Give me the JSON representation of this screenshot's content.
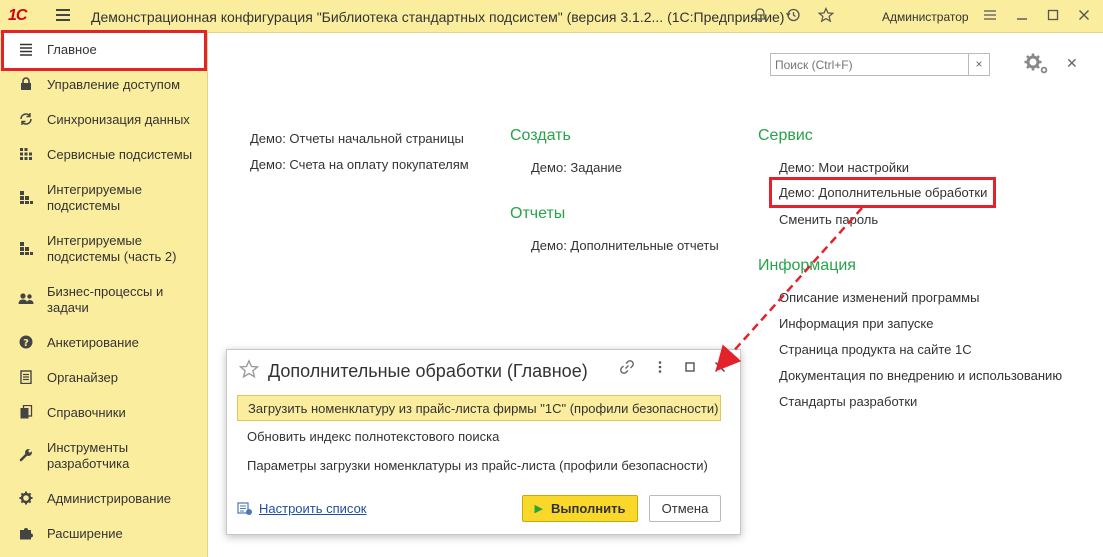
{
  "titlebar": {
    "logo": "1С",
    "title": "Демонстрационная конфигурация \"Библиотека стандартных подсистем\" (версия 3.1.2...   (1С:Предприятие)",
    "user": "Администратор"
  },
  "sidebar": {
    "items": [
      {
        "label": "Главное",
        "icon": "menu-icon"
      },
      {
        "label": "Управление доступом",
        "icon": "lock-icon"
      },
      {
        "label": "Синхронизация данных",
        "icon": "sync-icon"
      },
      {
        "label": "Сервисные подсистемы",
        "icon": "grid-icon"
      },
      {
        "label": "Интегрируемые подсистемы",
        "icon": "blocks-icon"
      },
      {
        "label": "Интегрируемые подсистемы (часть 2)",
        "icon": "blocks-icon"
      },
      {
        "label": "Бизнес-процессы и задачи",
        "icon": "users-icon"
      },
      {
        "label": "Анкетирование",
        "icon": "question-icon"
      },
      {
        "label": "Органайзер",
        "icon": "organizer-icon"
      },
      {
        "label": "Справочники",
        "icon": "books-icon"
      },
      {
        "label": "Инструменты разработчика",
        "icon": "wrench-icon"
      },
      {
        "label": "Администрирование",
        "icon": "gear-icon"
      },
      {
        "label": "Расширение",
        "icon": "puzzle-icon"
      }
    ]
  },
  "main": {
    "search_placeholder": "Поиск (Ctrl+F)",
    "col1": [
      "Демо: Отчеты начальной страницы",
      "Демо: Счета на оплату покупателям"
    ],
    "create_title": "Создать",
    "create_items": [
      "Демо: Задание"
    ],
    "reports_title": "Отчеты",
    "reports_items": [
      "Демо: Дополнительные отчеты"
    ],
    "service_title": "Сервис",
    "service_items": [
      "Демо: Мои настройки",
      "Демо: Дополнительные обработки",
      "Сменить пароль"
    ],
    "info_title": "Информация",
    "info_items": [
      "Описание изменений программы",
      "Информация при запуске",
      "Страница продукта на сайте 1С",
      "Документация по внедрению и использованию",
      "Стандарты разработки"
    ]
  },
  "dialog": {
    "title": "Дополнительные обработки (Главное)",
    "rows": [
      "Загрузить номенклатуру из прайс-листа фирмы \"1С\" (профили безопасности)",
      "Обновить индекс полнотекстового поиска",
      "Параметры загрузки номенклатуры из прайс-листа (профили безопасности)"
    ],
    "configure_label": "Настроить список",
    "run_label": "Выполнить",
    "cancel_label": "Отмена"
  },
  "colors": {
    "accent_yellow": "#fbed9e",
    "group_green": "#27a34a",
    "highlight_red": "#e3222b"
  }
}
